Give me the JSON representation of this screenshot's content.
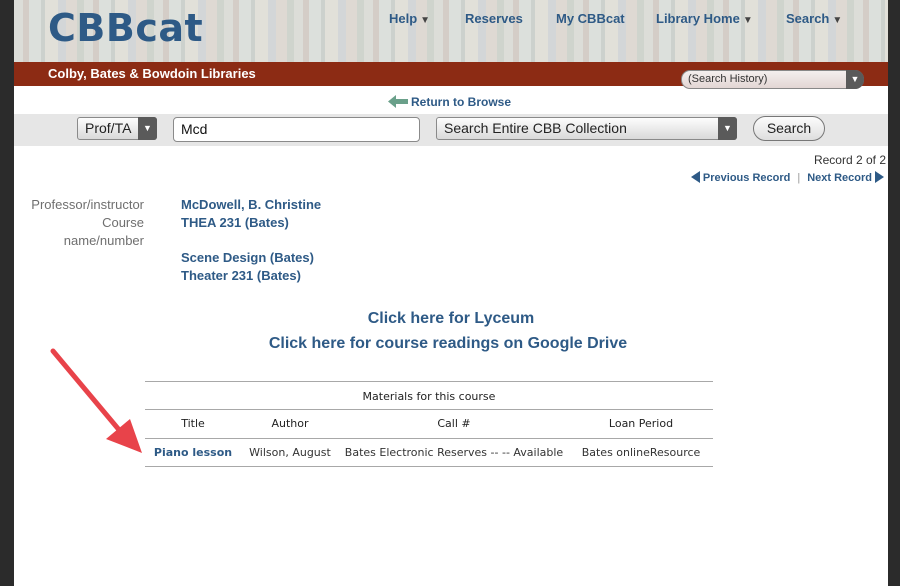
{
  "header": {
    "logo": "CBBcat",
    "nav": [
      {
        "label": "Help",
        "caret": "▼"
      },
      {
        "label": "Reserves",
        "caret": ""
      },
      {
        "label": "My CBBcat",
        "caret": ""
      },
      {
        "label": "Library Home",
        "caret": "▼"
      },
      {
        "label": "Search",
        "caret": "▼"
      }
    ]
  },
  "banner": {
    "library_name": "Colby, Bates & Bowdoin Libraries",
    "search_history": "(Search History)"
  },
  "return_link": "Return to Browse",
  "search": {
    "type_select": "Prof/TA",
    "query": "Mcd",
    "scope_select": "Search Entire CBB Collection",
    "button": "Search"
  },
  "record": {
    "count": "Record 2 of 2",
    "previous": "Previous Record",
    "next": "Next Record",
    "separator": "|"
  },
  "fields": {
    "label_prof": "Professor/instructor",
    "label_course_1": "Course",
    "label_course_2": "name/number",
    "professor": "McDowell, B. Christine",
    "course_number": "THEA 231 (Bates)",
    "course_name": "Scene Design (Bates)",
    "course_name_2": "Theater 231 (Bates)"
  },
  "links": {
    "lyceum": "Click here for Lyceum",
    "google_drive": "Click here for course readings on Google Drive"
  },
  "materials": {
    "caption": "Materials for this course",
    "columns": [
      "Title",
      "Author",
      "Call #",
      "Loan Period"
    ],
    "rows": [
      [
        "Piano lesson",
        "Wilson, August",
        "Bates Electronic Reserves -- -- Available",
        "Bates onlineResource"
      ]
    ]
  },
  "colors": {
    "link_blue": "#2e5a86",
    "banner_red": "#8c2b14",
    "annotation_arrow": "#e8434a"
  },
  "icons": {
    "return": "return-arrow-icon",
    "previous": "left-triangle-icon",
    "next": "right-triangle-icon",
    "dropdown": "chevron-down-icon",
    "annotation": "red-arrow-annotation"
  }
}
